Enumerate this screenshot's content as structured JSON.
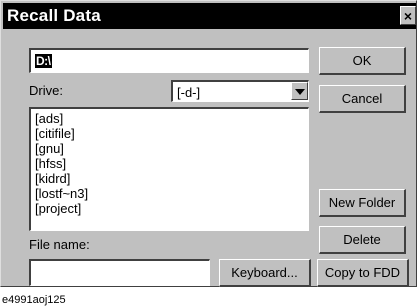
{
  "dialog": {
    "title": "Recall Data",
    "close_glyph": "×"
  },
  "path_field": {
    "value": "D:\\"
  },
  "drive": {
    "label": "Drive:",
    "selected": "[-d-]"
  },
  "directory_list": {
    "items": [
      "[ads]",
      "[citifile]",
      "[gnu]",
      "[hfss]",
      "[kidrd]",
      "[lostf~n3]",
      "[project]"
    ]
  },
  "file_name": {
    "label": "File name:",
    "value": ""
  },
  "buttons": {
    "ok": "OK",
    "cancel": "Cancel",
    "new_folder": "New Folder",
    "delete": "Delete",
    "keyboard": "Keyboard...",
    "copy_to_fdd": "Copy to FDD"
  },
  "caption": "e4991aoj125"
}
